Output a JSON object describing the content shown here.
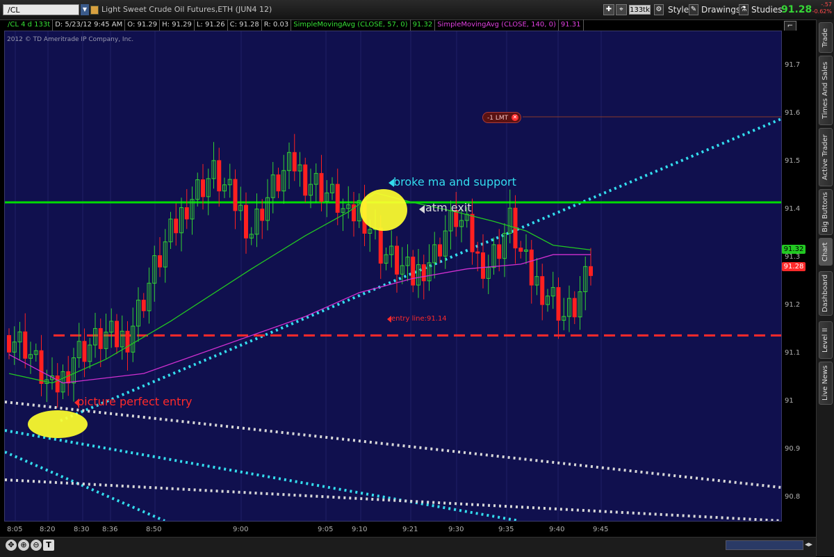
{
  "toolbar": {
    "symbol": "/CL",
    "instrument_title": "Light Sweet Crude Oil Futures,ETH (JUN4 12)",
    "tick_badge": "133tk",
    "style_label": "Style",
    "drawings_label": "Drawings",
    "studies_label": "Studies",
    "last_price": "91.28",
    "change_abs": "-.57",
    "change_pct": "-0.62%"
  },
  "infobar": {
    "symbol_period": "/CL 4 d 133t",
    "date": "D: 5/23/12 9:45 AM",
    "open": "O: 91.29",
    "high": "H: 91.29",
    "low": "L: 91.26",
    "close": "C: 91.28",
    "range": "R: 0.03",
    "ma57_label": "SimpleMovingAvg (CLOSE, 57, 0)",
    "ma57_value": "91.32",
    "ma140_label": "SimpleMovingAvg (CLOSE, 140, 0)",
    "ma140_value": "91.31"
  },
  "copyright": "2012 © TD Ameritrade IP Company, Inc.",
  "order_label": "-1 LMT",
  "annotations": {
    "broke": "broke ma and support",
    "atm": "atm exit",
    "entry_line": "entry line:91.14",
    "picture": "picture perfect entry"
  },
  "price_axis": [
    "91.7",
    "91.6",
    "91.5",
    "91.4",
    "91.3",
    "91.2",
    "91.1",
    "91",
    "90.9",
    "90.8"
  ],
  "price_labels": {
    "ma57": "91.32",
    "last": "91.28"
  },
  "time_axis": [
    "8:05",
    "8:20",
    "8:30",
    "8:36",
    "8:50",
    "9:00",
    "9:05",
    "9:10",
    "9:21",
    "9:30",
    "9:35",
    "9:40",
    "9:45"
  ],
  "sidebar_tabs": [
    "Trade",
    "Times And Sales",
    "Active Trader",
    "Big Buttons",
    "Chart",
    "Dashboard",
    "Level II",
    "Live News"
  ],
  "colors": {
    "background": "#10104e",
    "up": "#32d232",
    "down": "#ff2020",
    "ma57": "#22c822",
    "ma140": "#d030d0",
    "support": "#00dd00",
    "trend": "#33ddee",
    "entry": "#ff2a2a",
    "highlight": "#ffff2e"
  },
  "chart_data": {
    "type": "candlestick",
    "symbol": "/CL",
    "timeframe": "133 tick",
    "ylim": [
      90.75,
      91.78
    ],
    "yticks": [
      91.7,
      91.6,
      91.5,
      91.4,
      91.3,
      91.2,
      91.1,
      91.0,
      90.9,
      90.8
    ],
    "xticks": [
      "8:05",
      "8:20",
      "8:30",
      "8:36",
      "8:50",
      "9:00",
      "9:05",
      "9:10",
      "9:21",
      "9:30",
      "9:35",
      "9:40",
      "9:45"
    ],
    "entry_line": 91.14,
    "support_line": 91.42,
    "limit_order": 91.6,
    "ohlc_last": {
      "open": 91.29,
      "high": 91.29,
      "low": 91.26,
      "close": 91.28
    },
    "close_path": [
      [
        0,
        91.14
      ],
      [
        3,
        91.12
      ],
      [
        6,
        91.06
      ],
      [
        8,
        91.02
      ],
      [
        10,
        91.05
      ],
      [
        12,
        91.1
      ],
      [
        15,
        91.12
      ],
      [
        18,
        91.14
      ],
      [
        20,
        91.13
      ],
      [
        22,
        91.14
      ],
      [
        25,
        91.22
      ],
      [
        27,
        91.28
      ],
      [
        29,
        91.33
      ],
      [
        31,
        91.37
      ],
      [
        33,
        91.42
      ],
      [
        36,
        91.46
      ],
      [
        38,
        91.48
      ],
      [
        40,
        91.45
      ],
      [
        43,
        91.4
      ],
      [
        45,
        91.36
      ],
      [
        47,
        91.41
      ],
      [
        49,
        91.45
      ],
      [
        51,
        91.48
      ],
      [
        53,
        91.5
      ],
      [
        55,
        91.47
      ],
      [
        57,
        91.46
      ],
      [
        59,
        91.44
      ],
      [
        61,
        91.42
      ],
      [
        63,
        91.38
      ],
      [
        65,
        91.41
      ],
      [
        67,
        91.37
      ],
      [
        69,
        91.32
      ],
      [
        71,
        91.3
      ],
      [
        73,
        91.28
      ],
      [
        75,
        91.26
      ],
      [
        77,
        91.29
      ],
      [
        79,
        91.31
      ],
      [
        81,
        91.36
      ],
      [
        83,
        91.39
      ],
      [
        85,
        91.36
      ],
      [
        87,
        91.3
      ],
      [
        89,
        91.29
      ],
      [
        91,
        91.33
      ],
      [
        93,
        91.38
      ],
      [
        95,
        91.31
      ],
      [
        97,
        91.26
      ],
      [
        99,
        91.24
      ],
      [
        101,
        91.22
      ],
      [
        103,
        91.18
      ],
      [
        105,
        91.2
      ],
      [
        107,
        91.25
      ],
      [
        108,
        91.28
      ]
    ],
    "series": [
      {
        "name": "SimpleMovingAvg (CLOSE, 57, 0)",
        "last": 91.32,
        "values": [
          [
            0,
            91.06
          ],
          [
            8,
            91.04
          ],
          [
            18,
            91.09
          ],
          [
            30,
            91.17
          ],
          [
            45,
            91.28
          ],
          [
            55,
            91.35
          ],
          [
            63,
            91.4
          ],
          [
            68,
            91.44
          ],
          [
            75,
            91.42
          ],
          [
            83,
            91.4
          ],
          [
            90,
            91.38
          ],
          [
            96,
            91.36
          ],
          [
            101,
            91.33
          ],
          [
            108,
            91.32
          ]
        ]
      },
      {
        "name": "SimpleMovingAvg (CLOSE, 140, 0)",
        "last": 91.31,
        "values": [
          [
            0,
            91.1
          ],
          [
            10,
            91.04
          ],
          [
            25,
            91.06
          ],
          [
            40,
            91.12
          ],
          [
            55,
            91.18
          ],
          [
            65,
            91.23
          ],
          [
            75,
            91.26
          ],
          [
            85,
            91.28
          ],
          [
            95,
            91.29
          ],
          [
            101,
            91.31
          ],
          [
            108,
            91.31
          ]
        ]
      }
    ]
  }
}
